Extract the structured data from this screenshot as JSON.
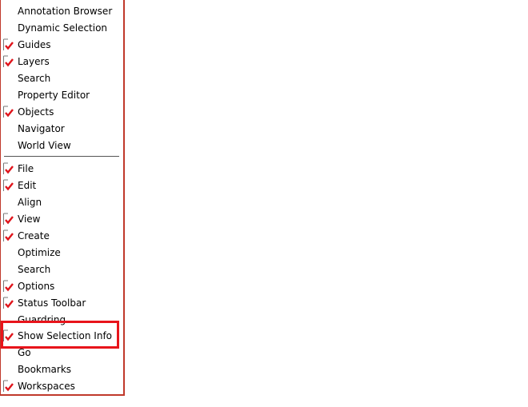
{
  "menu": {
    "items": [
      {
        "label": "Annotation Browser",
        "checked": false
      },
      {
        "label": "Dynamic Selection",
        "checked": false
      },
      {
        "label": "Guides",
        "checked": true
      },
      {
        "label": "Layers",
        "checked": true
      },
      {
        "label": "Search",
        "checked": false
      },
      {
        "label": "Property Editor",
        "checked": false
      },
      {
        "label": "Objects",
        "checked": true
      },
      {
        "label": "Navigator",
        "checked": false
      },
      {
        "label": "World View",
        "checked": false
      },
      {
        "label": "File",
        "checked": true
      },
      {
        "label": "Edit",
        "checked": true
      },
      {
        "label": "Align",
        "checked": false
      },
      {
        "label": "View",
        "checked": true
      },
      {
        "label": "Create",
        "checked": true
      },
      {
        "label": "Optimize",
        "checked": false
      },
      {
        "label": "Search",
        "checked": false
      },
      {
        "label": "Options",
        "checked": true
      },
      {
        "label": "Status Toolbar",
        "checked": true
      },
      {
        "label": "Guardring",
        "checked": false
      },
      {
        "label": "Show Selection Info",
        "checked": true
      },
      {
        "label": "Go",
        "checked": false
      },
      {
        "label": "Bookmarks",
        "checked": false
      },
      {
        "label": "Workspaces",
        "checked": true
      }
    ]
  },
  "colors": {
    "check": "#e0141b",
    "highlight": "#e8141b",
    "border": "#c0392b"
  }
}
